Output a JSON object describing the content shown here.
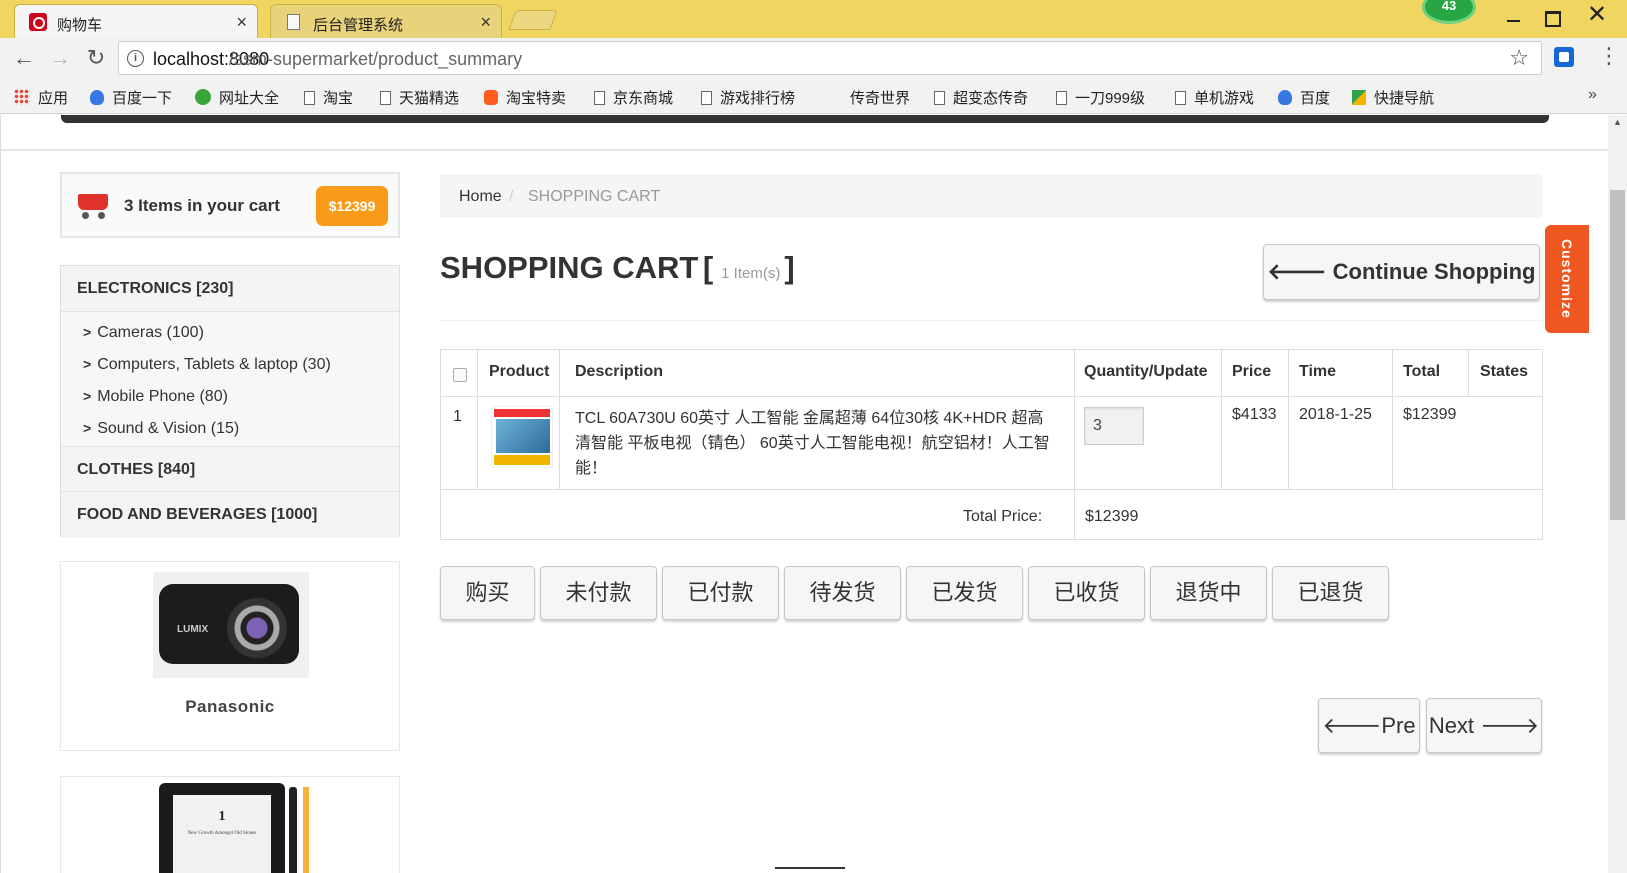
{
  "browser": {
    "tabs": [
      {
        "title": "购物车",
        "close": "×"
      },
      {
        "title": "后台管理系统",
        "close": "×"
      }
    ],
    "profile_badge": "43",
    "window_close": "✕",
    "url_host": "localhost:8080",
    "url_path": "/ssm-supermarket/product_summary",
    "bookmarks": [
      {
        "label": "应用",
        "icon": "apps-icon"
      },
      {
        "label": "百度一下",
        "icon": "paw-icon"
      },
      {
        "label": "网址大全",
        "icon": "green-plus-icon"
      },
      {
        "label": "淘宝",
        "icon": "page-icon"
      },
      {
        "label": "天猫精选",
        "icon": "page-icon"
      },
      {
        "label": "淘宝特卖",
        "icon": "taobao-icon"
      },
      {
        "label": "京东商城",
        "icon": "page-icon"
      },
      {
        "label": "游戏排行榜",
        "icon": "page-icon"
      },
      {
        "label": "传奇世界",
        "icon": "none"
      },
      {
        "label": "超变态传奇",
        "icon": "page-icon"
      },
      {
        "label": "一刀999级",
        "icon": "page-icon"
      },
      {
        "label": "单机游戏",
        "icon": "page-icon"
      },
      {
        "label": "百度",
        "icon": "paw-icon"
      },
      {
        "label": "快捷导航",
        "icon": "2345-icon"
      }
    ],
    "bookmarks_more": "»"
  },
  "customize": {
    "label": "Customize"
  },
  "sidebar": {
    "cart": {
      "items_text": "3 Items in your cart",
      "total": "$12399"
    },
    "categories": [
      {
        "label": "ELECTRONICS [230]"
      },
      {
        "label": "CLOTHES [840]"
      },
      {
        "label": "FOOD AND BEVERAGES [1000]"
      }
    ],
    "subcategories": [
      {
        "label": "Cameras (100)"
      },
      {
        "label": "Computers, Tablets & laptop (30)"
      },
      {
        "label": "Mobile Phone (80)"
      },
      {
        "label": "Sound & Vision (15)"
      }
    ],
    "products": [
      {
        "name": "Panasonic",
        "image_text": "LUMIX"
      },
      {
        "name": "",
        "image_number": "1",
        "image_text": "New Growth Amongst Old Stones"
      }
    ]
  },
  "main": {
    "breadcrumb": {
      "home": "Home",
      "separator": "/",
      "current": "SHOPPING CART"
    },
    "title": {
      "main": "SHOPPING CART",
      "open": "[",
      "count": "1 Item(s)",
      "close": "]"
    },
    "continue_button": "Continue Shopping",
    "table": {
      "headers": {
        "product": "Product",
        "description": "Description",
        "quantity": "Quantity/Update",
        "price": "Price",
        "time": "Time",
        "total": "Total",
        "states": "States"
      },
      "rows": [
        {
          "index": "1",
          "description": "TCL 60A730U 60英寸 人工智能 金属超薄 64位30核 4K+HDR 超高清智能 平板电视（锖色） 60英寸人工智能电视！航空铝材！人工智能！",
          "quantity": "3",
          "price": "$4133",
          "time": "2018-1-25",
          "total": "$12399",
          "state": ""
        }
      ],
      "total_label": "Total Price:",
      "total_value": "$12399"
    },
    "status_buttons": [
      {
        "label": "购买"
      },
      {
        "label": "未付款"
      },
      {
        "label": "已付款"
      },
      {
        "label": "待发货"
      },
      {
        "label": "已发货"
      },
      {
        "label": "已收货"
      },
      {
        "label": "退货中"
      },
      {
        "label": "已退货"
      }
    ],
    "pagination": {
      "pre": "Pre",
      "next": "Next"
    }
  }
}
